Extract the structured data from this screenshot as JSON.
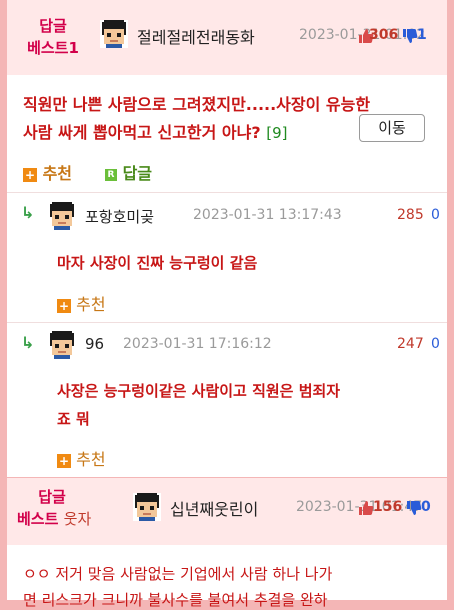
{
  "best_post": {
    "badge_line1": "답글",
    "badge_line2": "베스트1",
    "nickname": "절레절레전래동화",
    "date": "2023-01-31 01:02",
    "upvotes": "306",
    "downvotes": "1",
    "title": "직원만 나쁜 사람으로 그려졌지만.....사장이 유능한",
    "title_line2": "사람 싸게 뽑아먹고 신고한거 아냐?",
    "comment_count": "[9]",
    "move_button": "이동",
    "recommend_label": "추천",
    "reply_label": "답글",
    "reply_icon": "R"
  },
  "replies": [
    {
      "nickname": "포항호미곶",
      "date": "2023-01-31 13:17:43",
      "upvotes": "285",
      "downvotes": "0",
      "content": "마자 사장이 진짜 능구렁이 같음",
      "recommend_label": "추천"
    },
    {
      "nickname": "96",
      "date": "2023-01-31 17:16:12",
      "upvotes": "247",
      "downvotes": "0",
      "content_line1": "사장은 능구렁이같은 사람이고 직원은 범죄자",
      "content_line2": "죠 뭐",
      "recommend_label": "추천"
    }
  ],
  "second_best": {
    "badge_line1": "답글",
    "badge_line2": "베스트",
    "badge_suffix": "웃자",
    "nickname": "십년째웃린이",
    "date": "2023-01-31 01:47",
    "upvotes": "156",
    "downvotes": "0",
    "content_line1": "ㅇㅇ 저거 맞음 사람없는 기업에서 사람 하나 나가",
    "content_line2": "면 리스크가 크니까 불사수를 불여서 추결을 완하"
  },
  "icons": {
    "thumb_up": "thumbs-up-icon",
    "thumb_down": "thumbs-down-icon",
    "reply_arrow": "reply-arrow-icon",
    "avatar": "pixel-avatar-icon"
  },
  "colors": {
    "accent_red": "#c71616",
    "badge_pink": "#d2004a",
    "header_bg": "#ffe8e8",
    "border_pink": "#f4b6b6",
    "up_red": "#c0392b",
    "down_blue": "#2a5cd8"
  }
}
